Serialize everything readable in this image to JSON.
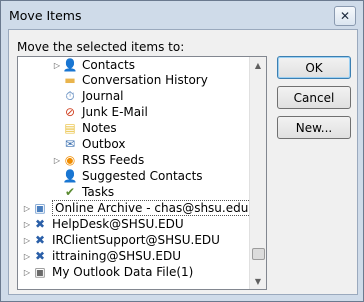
{
  "window": {
    "title": "Move Items",
    "close_glyph": "✕"
  },
  "prompt": "Move the selected items to:",
  "tree": [
    {
      "label": "Contacts",
      "icon": "contacts-icon",
      "glyph": "👤",
      "color": "#4a7fbf",
      "expander": "▷"
    },
    {
      "label": "Conversation History",
      "icon": "folder-icon",
      "glyph": "▬",
      "color": "#e9b44c",
      "expander": ""
    },
    {
      "label": "Journal",
      "icon": "journal-icon",
      "glyph": "⏱",
      "color": "#3a6fb0",
      "expander": ""
    },
    {
      "label": "Junk E-Mail",
      "icon": "junk-email-icon",
      "glyph": "⊘",
      "color": "#d04020",
      "expander": ""
    },
    {
      "label": "Notes",
      "icon": "notes-icon",
      "glyph": "▤",
      "color": "#e9c03c",
      "expander": ""
    },
    {
      "label": "Outbox",
      "icon": "outbox-icon",
      "glyph": "✉",
      "color": "#3a6fb0",
      "expander": ""
    },
    {
      "label": "RSS Feeds",
      "icon": "rss-icon",
      "glyph": "◉",
      "color": "#f08c00",
      "expander": "▷"
    },
    {
      "label": "Suggested Contacts",
      "icon": "suggested-contacts-icon",
      "glyph": "👤",
      "color": "#4a7fbf",
      "expander": ""
    },
    {
      "label": "Tasks",
      "icon": "tasks-icon",
      "glyph": "✔",
      "color": "#5a8a30",
      "expander": ""
    },
    {
      "label": "Online Archive - chas@shsu.edu",
      "icon": "archive-icon",
      "glyph": "▣",
      "color": "#4a7fbf",
      "expander": "▷"
    },
    {
      "label": "HelpDesk@SHSU.EDU",
      "icon": "exchange-icon",
      "glyph": "✖",
      "color": "#2a5fa8",
      "expander": "▷"
    },
    {
      "label": "IRClientSupport@SHSU.EDU",
      "icon": "exchange-icon",
      "glyph": "✖",
      "color": "#2a5fa8",
      "expander": "▷"
    },
    {
      "label": "ittraining@SHSU.EDU",
      "icon": "exchange-icon",
      "glyph": "✖",
      "color": "#2a5fa8",
      "expander": "▷"
    },
    {
      "label": "My Outlook Data File(1)",
      "icon": "data-file-icon",
      "glyph": "▣",
      "color": "#6a6a6a",
      "expander": "▷"
    }
  ],
  "buttons": {
    "ok": "OK",
    "cancel": "Cancel",
    "new": "New..."
  },
  "scrollbar": {
    "up_glyph": "▲",
    "down_glyph": "▼",
    "position": 0.93
  }
}
